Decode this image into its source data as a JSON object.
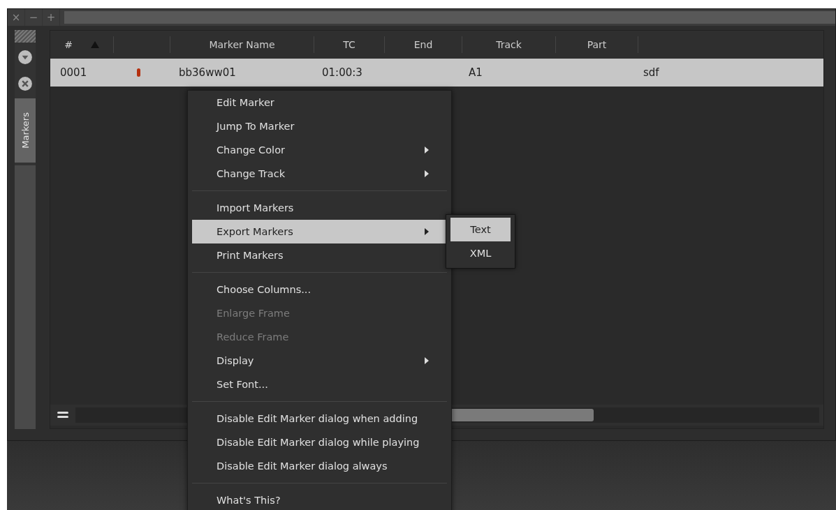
{
  "window": {
    "controls": [
      "×",
      "−",
      "+"
    ]
  },
  "side_tab": {
    "label": "Markers"
  },
  "table": {
    "columns": [
      {
        "label": "#",
        "sorted": true
      },
      {
        "sorted": false
      },
      {
        "label": "Marker Name",
        "sorted": false
      },
      {
        "label": "TC",
        "sorted": false
      },
      {
        "label": "End",
        "sorted": false
      },
      {
        "label": "Track",
        "sorted": false
      },
      {
        "label": "Part",
        "sorted": false
      }
    ],
    "rows": [
      {
        "selected": true,
        "number": "0001",
        "color": "#b5300f",
        "marker_name": "bb36ww01",
        "tc": "01:00:3",
        "track": "A1",
        "comment": "sdf"
      }
    ]
  },
  "context_menu": {
    "items": [
      {
        "kind": "item",
        "label": "Edit Marker",
        "submenu": false,
        "disabled": false,
        "selected": false
      },
      {
        "kind": "item",
        "label": "Jump To Marker",
        "submenu": false,
        "disabled": false,
        "selected": false
      },
      {
        "kind": "item",
        "label": "Change Color",
        "submenu": true,
        "disabled": false,
        "selected": false
      },
      {
        "kind": "item",
        "label": "Change Track",
        "submenu": true,
        "disabled": false,
        "selected": false
      },
      {
        "kind": "separator"
      },
      {
        "kind": "item",
        "label": "Import Markers",
        "submenu": false,
        "disabled": false,
        "selected": false
      },
      {
        "kind": "item",
        "label": "Export Markers",
        "submenu": true,
        "disabled": false,
        "selected": true
      },
      {
        "kind": "item",
        "label": "Print Markers",
        "submenu": false,
        "disabled": false,
        "selected": false
      },
      {
        "kind": "separator"
      },
      {
        "kind": "item",
        "label": "Choose Columns...",
        "submenu": false,
        "disabled": false,
        "selected": false
      },
      {
        "kind": "item",
        "label": "Enlarge Frame",
        "submenu": false,
        "disabled": true,
        "selected": false
      },
      {
        "kind": "item",
        "label": "Reduce Frame",
        "submenu": false,
        "disabled": true,
        "selected": false
      },
      {
        "kind": "item",
        "label": "Display",
        "submenu": true,
        "disabled": false,
        "selected": false
      },
      {
        "kind": "item",
        "label": "Set Font...",
        "submenu": false,
        "disabled": false,
        "selected": false
      },
      {
        "kind": "separator"
      },
      {
        "kind": "item",
        "label": "Disable Edit Marker dialog when adding",
        "submenu": false,
        "disabled": false,
        "selected": false
      },
      {
        "kind": "item",
        "label": "Disable Edit Marker dialog while playing",
        "submenu": false,
        "disabled": false,
        "selected": false
      },
      {
        "kind": "item",
        "label": "Disable Edit Marker dialog always",
        "submenu": false,
        "disabled": false,
        "selected": false
      },
      {
        "kind": "separator"
      },
      {
        "kind": "item",
        "label": "What's This?",
        "submenu": false,
        "disabled": false,
        "selected": false
      }
    ],
    "submenu": [
      {
        "label": "Text",
        "selected": true
      },
      {
        "label": "XML",
        "selected": false
      }
    ]
  }
}
